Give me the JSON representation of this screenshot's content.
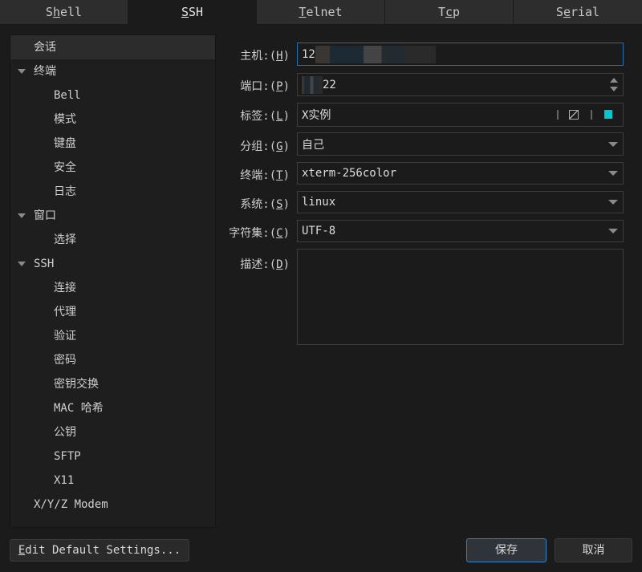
{
  "tabs": [
    {
      "label": "Shell",
      "key": "h",
      "pre": "S",
      "post": "ell"
    },
    {
      "label": "SSH",
      "pre": "",
      "key": "S",
      "post": "SH"
    },
    {
      "label": "Telnet",
      "pre": "",
      "key": "T",
      "post": "elnet"
    },
    {
      "label": "Tcp",
      "pre": "T",
      "key": "c",
      "post": "p"
    },
    {
      "label": "Serial",
      "pre": "S",
      "key": "e",
      "post": "rial"
    }
  ],
  "active_tab": "SSH",
  "tree": [
    {
      "label": "会话",
      "level": 0,
      "selected": true
    },
    {
      "label": "终端",
      "level": 0,
      "expanded": true
    },
    {
      "label": "Bell",
      "level": 1
    },
    {
      "label": "模式",
      "level": 1
    },
    {
      "label": "键盘",
      "level": 1
    },
    {
      "label": "安全",
      "level": 1
    },
    {
      "label": "日志",
      "level": 1
    },
    {
      "label": "窗口",
      "level": 0,
      "expanded": true
    },
    {
      "label": "选择",
      "level": 1
    },
    {
      "label": "SSH",
      "level": 0,
      "expanded": true
    },
    {
      "label": "连接",
      "level": 1
    },
    {
      "label": "代理",
      "level": 1
    },
    {
      "label": "验证",
      "level": 1
    },
    {
      "label": "密码",
      "level": 1
    },
    {
      "label": "密钥交换",
      "level": 1
    },
    {
      "label": "MAC 哈希",
      "level": 1
    },
    {
      "label": "公钥",
      "level": 1
    },
    {
      "label": "SFTP",
      "level": 1
    },
    {
      "label": "X11",
      "level": 1
    },
    {
      "label": "X/Y/Z Modem",
      "level": 0
    }
  ],
  "form": {
    "host": {
      "label": "主机:(",
      "key": "H",
      "end": ")",
      "value": "12"
    },
    "port": {
      "label": "端口:(",
      "key": "P",
      "end": ")",
      "value": "22"
    },
    "tag": {
      "label": "标签:(",
      "key": "L",
      "end": ")",
      "value": "X实例",
      "color": "#00c8d0"
    },
    "group": {
      "label": "分组:(",
      "key": "G",
      "end": ")",
      "value": "自己"
    },
    "terminal": {
      "label": "终端:(",
      "key": "T",
      "end": ")",
      "value": "xterm-256color"
    },
    "system": {
      "label": "系统:(",
      "key": "S",
      "end": ")",
      "value": "linux"
    },
    "charset": {
      "label": "字符集:(",
      "key": "C",
      "end": ")",
      "value": "UTF-8"
    },
    "description": {
      "label": "描述:(",
      "key": "D",
      "end": ")",
      "value": ""
    }
  },
  "buttons": {
    "edit_defaults_key": "E",
    "edit_defaults_rest": "dit Default Settings...",
    "save": "保存",
    "cancel": "取消"
  }
}
